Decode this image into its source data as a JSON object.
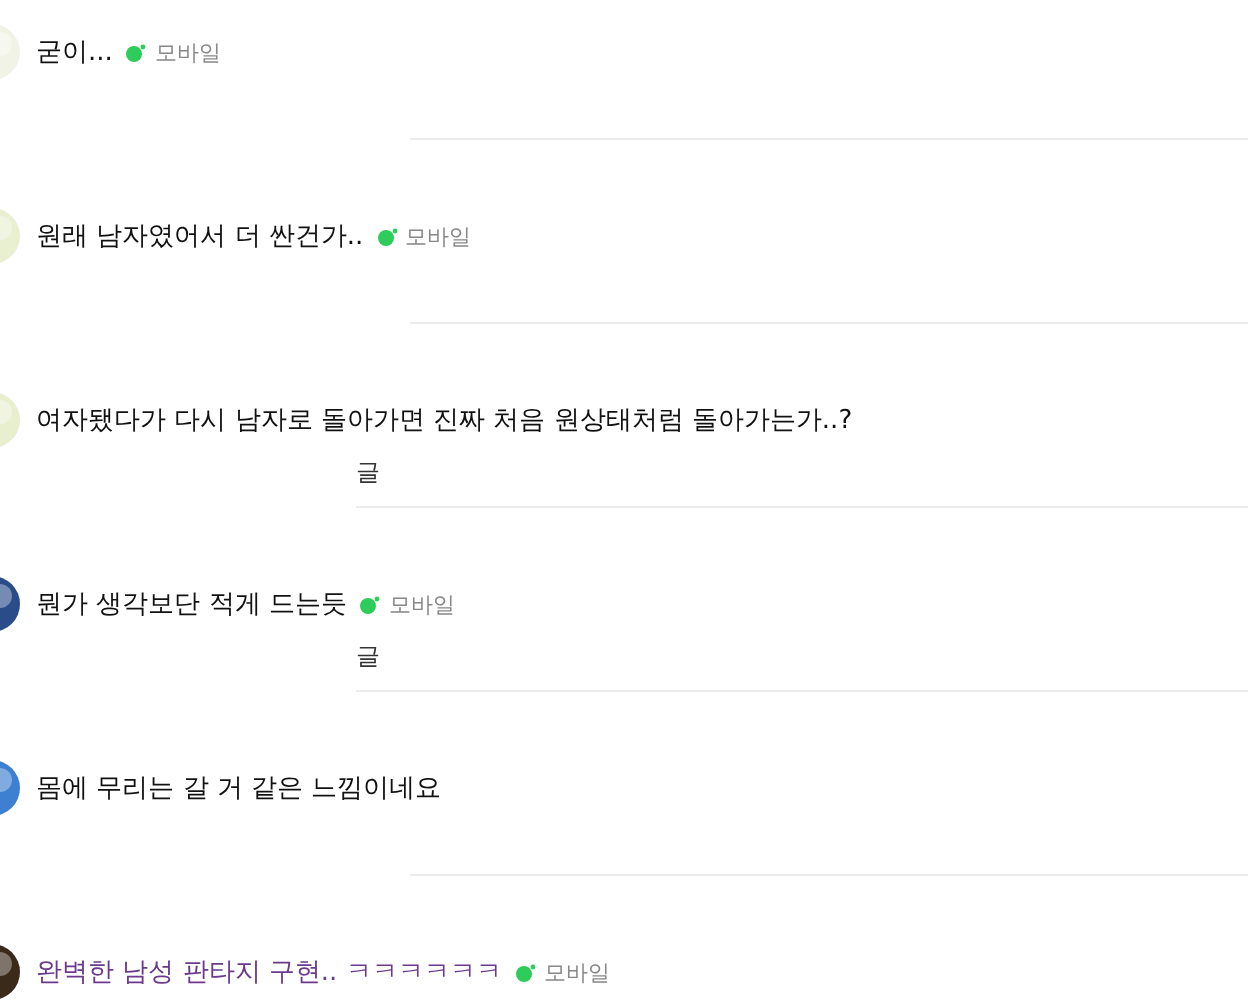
{
  "comments": [
    {
      "text": "굳이...",
      "mobile_label": "모바일",
      "visited": false
    },
    {
      "text": "원래 남자였어서 더 싼건가..",
      "mobile_label": "모바일",
      "visited": false
    },
    {
      "text": "여자됐다가 다시 남자로 돌아가면 진짜 처음 원상태처럼 돌아가는가..?",
      "visited": false,
      "reply": "글"
    },
    {
      "text": "뭔가 생각보단 적게 드는듯",
      "mobile_label": "모바일",
      "visited": false,
      "reply": "글"
    },
    {
      "text": "몸에 무리는 갈 거 같은 느낌이네요",
      "visited": false
    },
    {
      "text": "완벽한 남성 판타지 구현.. ㅋㅋㅋㅋㅋㅋ",
      "mobile_label": "모바일",
      "visited": true
    }
  ]
}
